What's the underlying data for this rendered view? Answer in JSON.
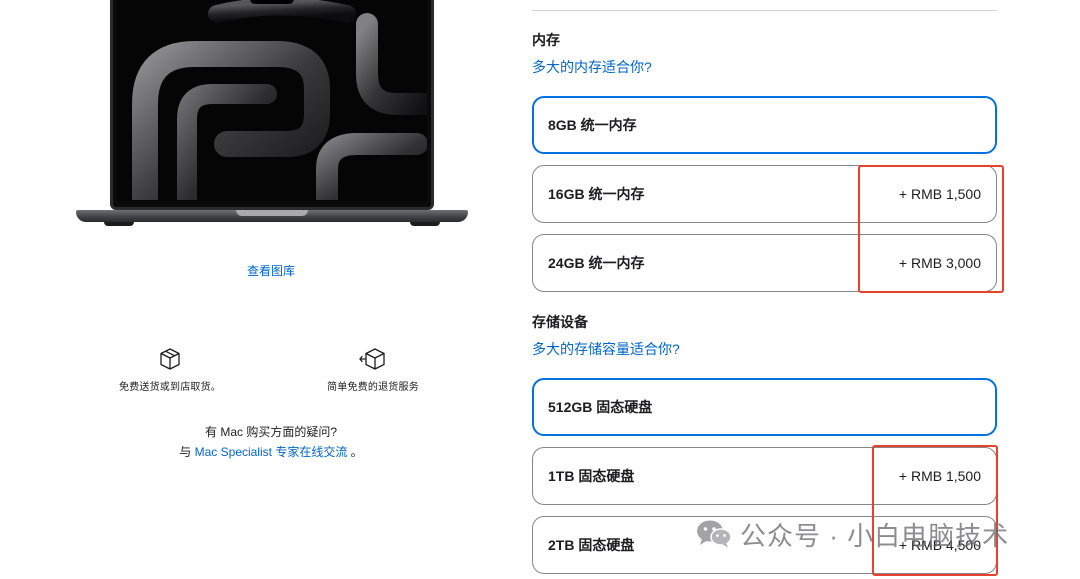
{
  "left": {
    "gallery_link": "查看图库",
    "services": [
      {
        "icon": "box-icon",
        "label": "免费送货或到店取货。"
      },
      {
        "icon": "box-return-icon",
        "label": "简单免费的退货服务"
      }
    ],
    "help_question": "有 Mac 购买方面的疑问?",
    "help_prefix": "与 ",
    "help_link": "Mac Specialist 专家在线交流",
    "help_suffix": " 。"
  },
  "memory": {
    "title": "内存",
    "help_link": "多大的内存适合你?",
    "options": [
      {
        "label": "8GB 统一内存",
        "price": "",
        "selected": true
      },
      {
        "label": "16GB 统一内存",
        "price": "+ RMB 1,500",
        "selected": false
      },
      {
        "label": "24GB 统一内存",
        "price": "+ RMB 3,000",
        "selected": false
      }
    ]
  },
  "storage": {
    "title": "存储设备",
    "help_link": "多大的存储容量适合你?",
    "options": [
      {
        "label": "512GB 固态硬盘",
        "price": "",
        "selected": true
      },
      {
        "label": "1TB 固态硬盘",
        "price": "+ RMB 1,500",
        "selected": false
      },
      {
        "label": "2TB 固态硬盘",
        "price": "+ RMB 4,500",
        "selected": false
      }
    ]
  },
  "watermark": {
    "icon": "wechat-icon",
    "text": "公众号 · 小白电脑技术"
  },
  "colors": {
    "link": "#0066cc",
    "selected_border": "#0071e3",
    "annotation_red": "#e8412c"
  }
}
